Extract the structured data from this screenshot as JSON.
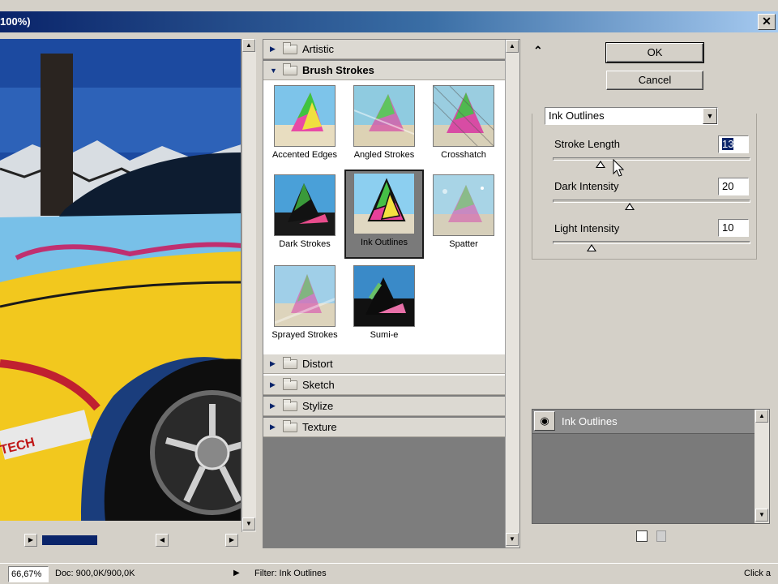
{
  "window": {
    "title_fragment": "100%)",
    "close_glyph": "✕"
  },
  "buttons": {
    "ok": "OK",
    "cancel": "Cancel"
  },
  "collapse_glyph": "⌃",
  "gallery": {
    "categories": [
      {
        "label": "Artistic",
        "open": false
      },
      {
        "label": "Brush Strokes",
        "open": true
      },
      {
        "label": "Distort",
        "open": false
      },
      {
        "label": "Sketch",
        "open": false
      },
      {
        "label": "Stylize",
        "open": false
      },
      {
        "label": "Texture",
        "open": false
      }
    ],
    "brush_strokes": [
      {
        "label": "Accented Edges",
        "selected": false
      },
      {
        "label": "Angled Strokes",
        "selected": false
      },
      {
        "label": "Crosshatch",
        "selected": false
      },
      {
        "label": "Dark Strokes",
        "selected": false
      },
      {
        "label": "Ink Outlines",
        "selected": true
      },
      {
        "label": "Spatter",
        "selected": false
      },
      {
        "label": "Sprayed Strokes",
        "selected": false
      },
      {
        "label": "Sumi-e",
        "selected": false
      }
    ]
  },
  "settings": {
    "filter": "Ink Outlines",
    "params": [
      {
        "label": "Stroke Length",
        "value": "13",
        "min": 1,
        "max": 50
      },
      {
        "label": "Dark Intensity",
        "value": "20",
        "min": 0,
        "max": 50
      },
      {
        "label": "Light Intensity",
        "value": "10",
        "min": 0,
        "max": 50
      }
    ]
  },
  "layers": {
    "items": [
      "Ink Outlines"
    ],
    "eye_icon": "eye-icon"
  },
  "preview": {
    "badge_text": "TECH"
  },
  "status": {
    "zoom": "66,67%",
    "doc": "Doc: 900,0K/900,0K",
    "filter": "Filter: Ink Outlines",
    "hint": "Click a"
  },
  "colors": {
    "selection": "#0a246a",
    "panel_gray": "#7d7d7d",
    "chrome": "#d4d0c8"
  }
}
